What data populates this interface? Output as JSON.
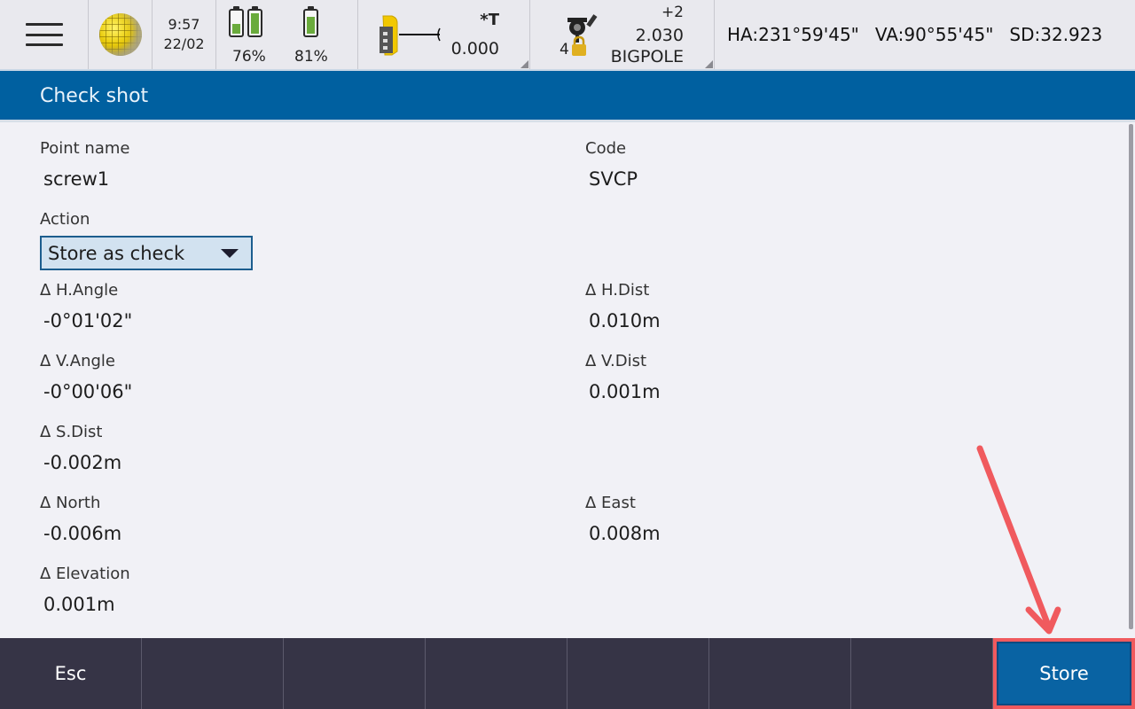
{
  "status_bar": {
    "menu_icon": "hamburger-menu-icon",
    "globe_icon": "globe-icon",
    "time": "9:57",
    "date": "22/02",
    "batteries": [
      {
        "label": "76%",
        "cells": [
          {
            "level": 0.45
          },
          {
            "level": 0.95
          }
        ]
      },
      {
        "label": "81%",
        "cells": [
          {
            "level": 0.81
          }
        ]
      }
    ],
    "instrument": {
      "icon": "total-station-icon",
      "prism_constant": "*T",
      "offset": "0.000"
    },
    "target": {
      "icon": "prism-target-icon",
      "target_number": "4",
      "lock_icon": "lock-icon",
      "prism_offset": "+2",
      "height": "2.030",
      "name": "BIGPOLE"
    },
    "readout": {
      "ha": "HA:231°59'45\"",
      "va": "VA:90°55'45\"",
      "sd": "SD:32.923"
    }
  },
  "title": "Check shot",
  "form": {
    "point_name": {
      "label": "Point name",
      "value": "screw1"
    },
    "code": {
      "label": "Code",
      "value": "SVCP"
    },
    "action": {
      "label": "Action",
      "value": "Store as check"
    },
    "deltas": {
      "h_angle": {
        "label": "Δ H.Angle",
        "value": "-0°01'02\""
      },
      "h_dist": {
        "label": "Δ H.Dist",
        "value": "0.010m"
      },
      "v_angle": {
        "label": "Δ V.Angle",
        "value": "-0°00'06\""
      },
      "v_dist": {
        "label": "Δ V.Dist",
        "value": "0.001m"
      },
      "s_dist": {
        "label": "Δ S.Dist",
        "value": "-0.002m"
      },
      "north": {
        "label": "Δ North",
        "value": "-0.006m"
      },
      "east": {
        "label": "Δ East",
        "value": "0.008m"
      },
      "elevation": {
        "label": "Δ Elevation",
        "value": "0.001m"
      }
    }
  },
  "softkeys": [
    {
      "label": "Esc"
    },
    {
      "label": ""
    },
    {
      "label": ""
    },
    {
      "label": ""
    },
    {
      "label": ""
    },
    {
      "label": ""
    },
    {
      "label": ""
    },
    {
      "label": "Store"
    }
  ],
  "colors": {
    "title_bar": "#0060a0",
    "softkey_bar": "#363446",
    "primary_button": "#0963a3",
    "annotation": "#f05a5e",
    "battery_fill": "#6aab3c"
  }
}
